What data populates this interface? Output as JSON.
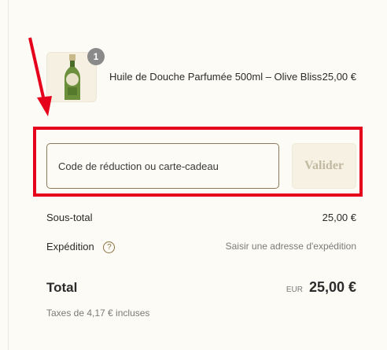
{
  "product": {
    "name": "Huile de Douche Parfumée 500ml – Olive Bliss",
    "price": "25,00 €",
    "quantity": "1",
    "thumbnail_icon": "olive-oil-bottle-icon"
  },
  "discount": {
    "placeholder": "Code de réduction ou carte-cadeau",
    "apply_label": "Valider"
  },
  "summary": {
    "subtotal_label": "Sous-total",
    "subtotal_value": "25,00 €",
    "shipping_label": "Expédition",
    "shipping_value": "Saisir une adresse d'expédition",
    "help_icon": "question-circle-icon",
    "total_label": "Total",
    "currency": "EUR",
    "total_value": "25,00 €",
    "taxes_note": "Taxes de 4,17 € incluses"
  },
  "colors": {
    "annotation_red": "#e5001c",
    "background": "#fdfbf5"
  }
}
